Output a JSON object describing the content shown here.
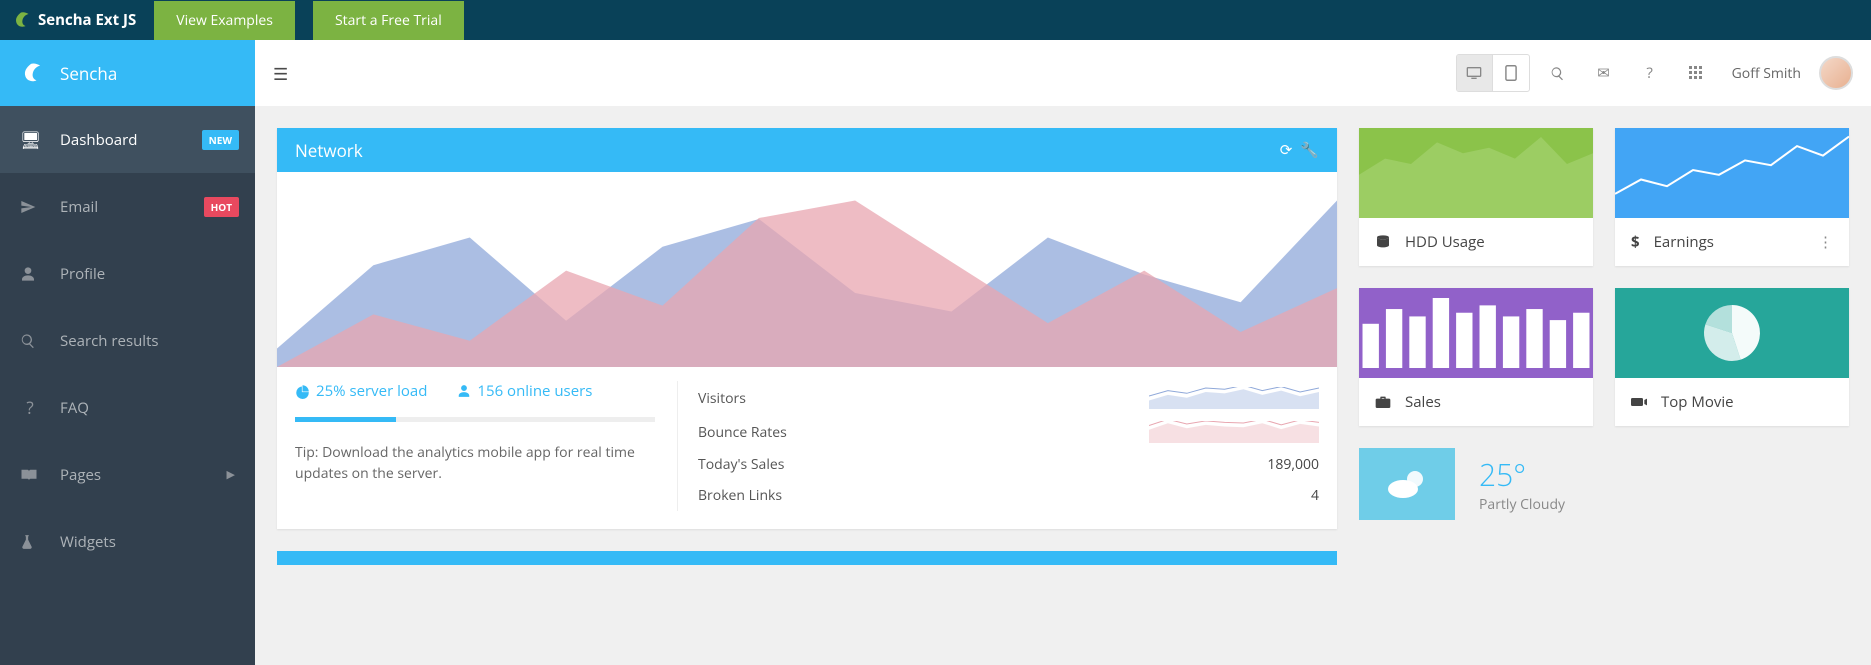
{
  "topbar": {
    "brand": "Sencha Ext JS",
    "btn1": "View Examples",
    "btn2": "Start a Free Trial"
  },
  "sidebar": {
    "title": "Sencha",
    "items": [
      {
        "label": "Dashboard",
        "badge": "NEW"
      },
      {
        "label": "Email",
        "badge": "HOT"
      },
      {
        "label": "Profile"
      },
      {
        "label": "Search results"
      },
      {
        "label": "FAQ"
      },
      {
        "label": "Pages",
        "sub": true
      },
      {
        "label": "Widgets"
      }
    ]
  },
  "header": {
    "username": "Goff Smith"
  },
  "network": {
    "title": "Network",
    "server_load": "25% server load",
    "online_users": "156 online users",
    "tip": "Tip: Download the analytics mobile app for real time updates on the server.",
    "stats": {
      "visitors_label": "Visitors",
      "bounce_label": "Bounce Rates",
      "today_label": "Today's Sales",
      "today_value": "189,000",
      "broken_label": "Broken Links",
      "broken_value": "4"
    }
  },
  "cards": {
    "hdd": "HDD Usage",
    "earnings": "Earnings",
    "sales": "Sales",
    "movie": "Top Movie"
  },
  "weather": {
    "temp": "25°",
    "cond": "Partly Cloudy"
  },
  "chart_data": {
    "network": {
      "type": "area",
      "x": [
        0,
        1,
        2,
        3,
        4,
        5,
        6,
        7,
        8,
        9,
        10,
        11
      ],
      "series": [
        {
          "name": "blue",
          "color": "#8fa8d9",
          "values": [
            10,
            55,
            70,
            25,
            65,
            80,
            40,
            30,
            70,
            50,
            35,
            90
          ]
        },
        {
          "name": "pink",
          "color": "#e8a6b0",
          "values": [
            0,
            30,
            15,
            55,
            35,
            85,
            95,
            60,
            25,
            55,
            20,
            45
          ]
        }
      ],
      "ylim": [
        0,
        100
      ]
    },
    "sparklines": {
      "visitors": {
        "type": "area",
        "color": "#8fa8d9",
        "values": [
          30,
          50,
          40,
          60,
          55,
          70,
          50,
          65,
          45,
          60
        ]
      },
      "bounce": {
        "type": "area",
        "color": "#e8a6b0",
        "values": [
          40,
          60,
          45,
          55,
          50,
          48,
          60,
          42,
          58,
          50
        ]
      }
    },
    "minicards": {
      "hdd": {
        "type": "area",
        "color": "#a8d474",
        "values": [
          40,
          55,
          50,
          70,
          60,
          65,
          55,
          75,
          50,
          60
        ]
      },
      "earnings": {
        "type": "line",
        "color": "#ffffff",
        "values": [
          20,
          35,
          28,
          45,
          40,
          55,
          50,
          70,
          60,
          80
        ]
      },
      "sales": {
        "type": "bar",
        "color": "#ffffff",
        "values": [
          60,
          80,
          70,
          95,
          75,
          85,
          70,
          80,
          65,
          75
        ]
      },
      "movie": {
        "type": "pie",
        "color": "#ffffff",
        "values": [
          45,
          35,
          20
        ]
      }
    }
  }
}
